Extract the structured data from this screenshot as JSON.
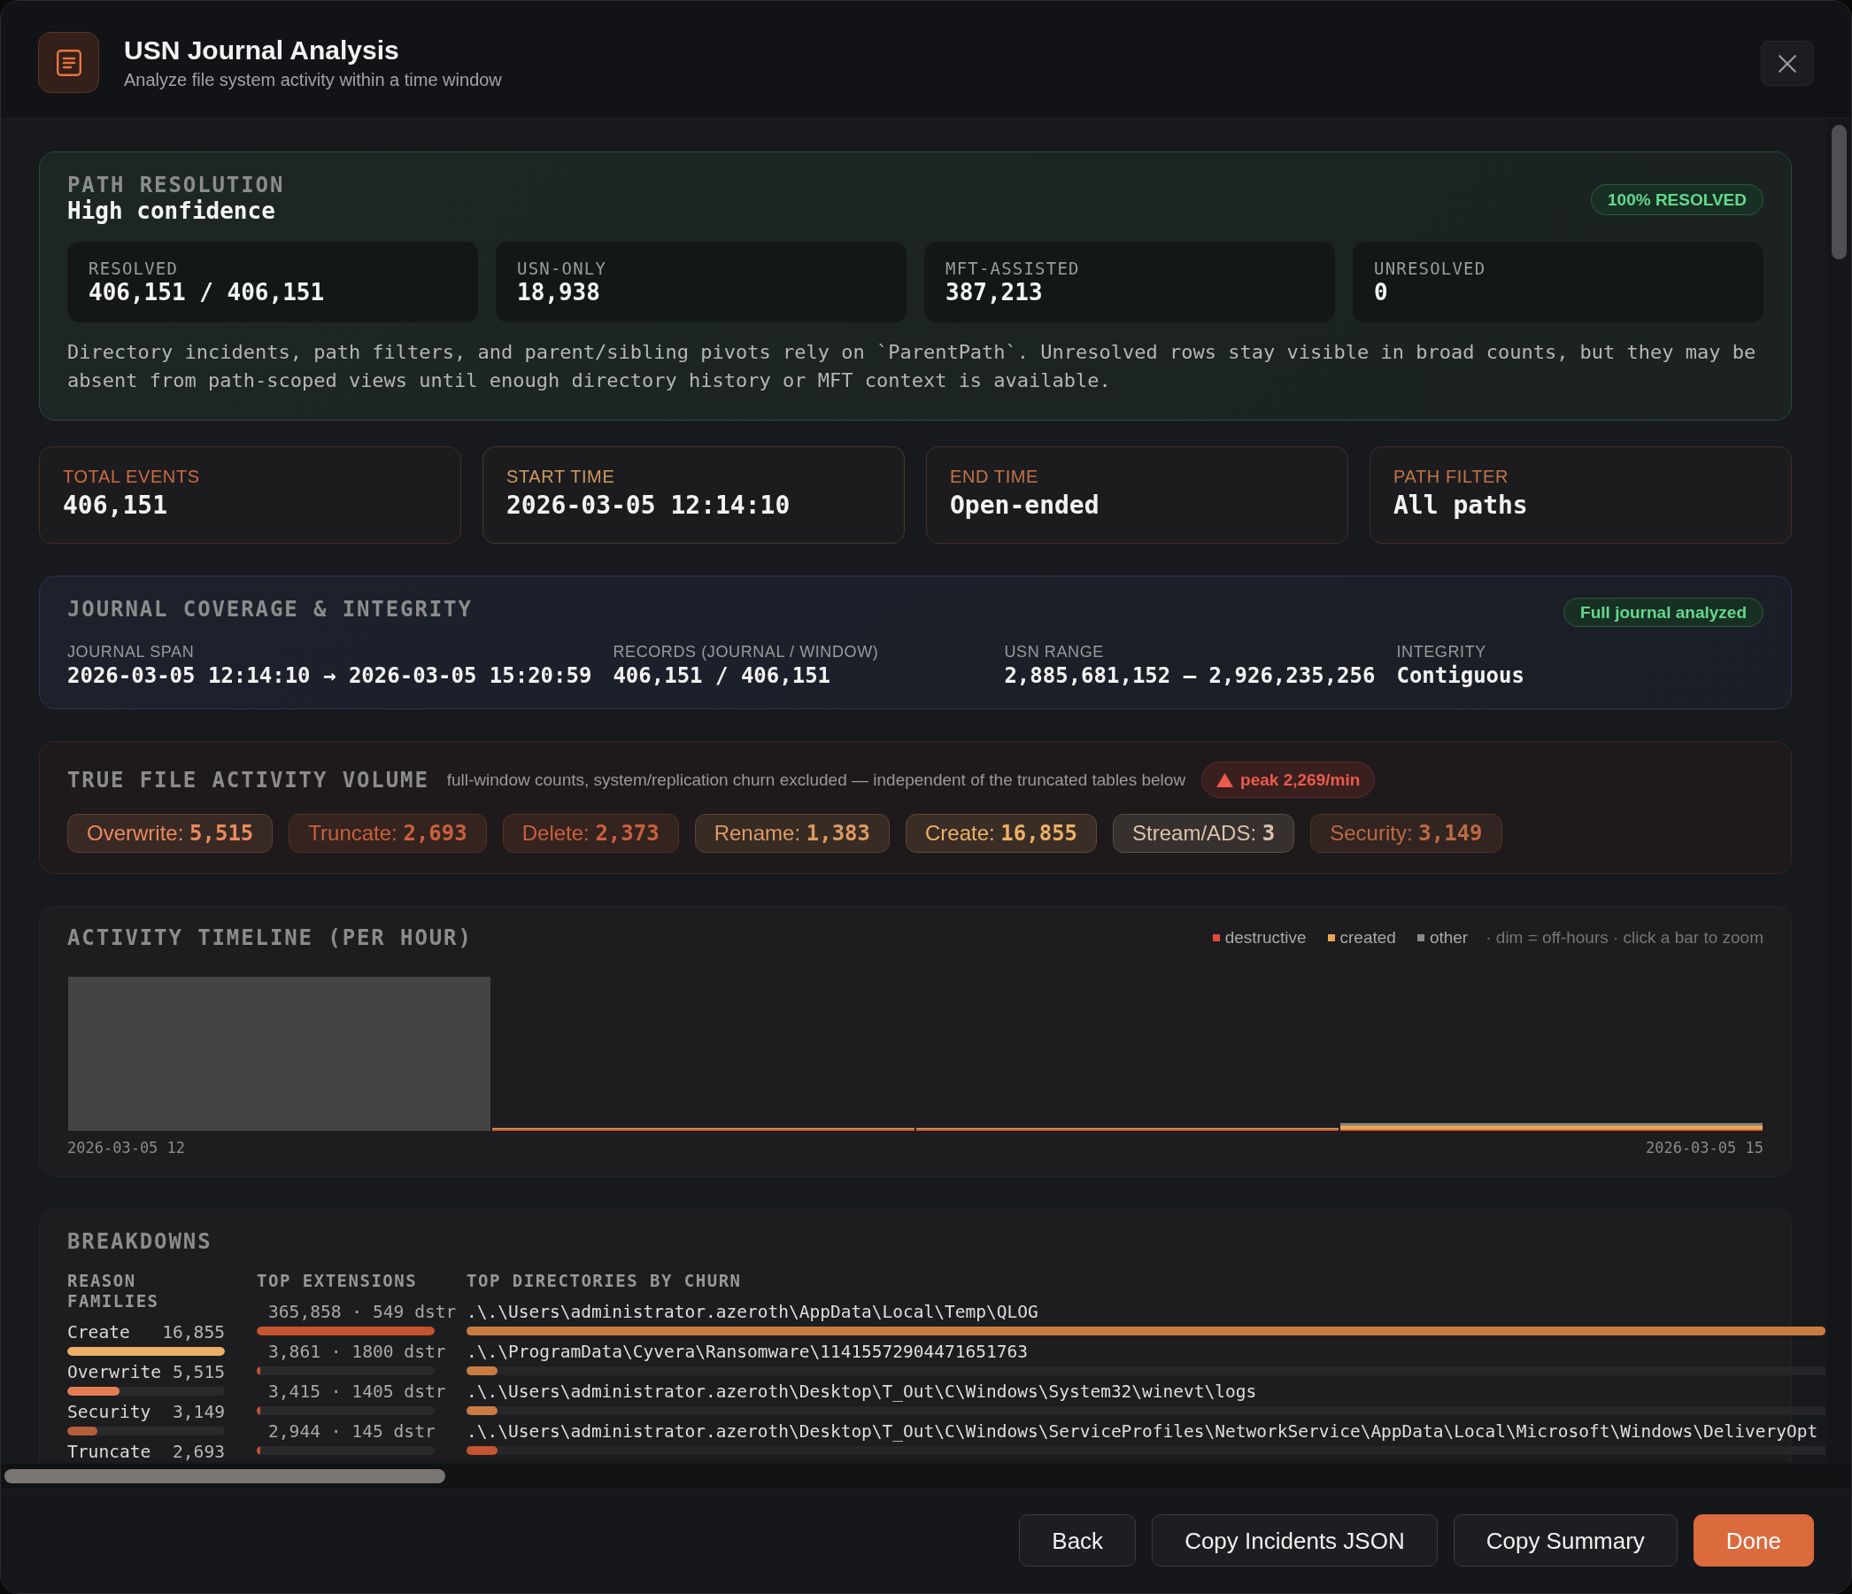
{
  "header": {
    "title": "USN Journal Analysis",
    "subtitle": "Analyze file system activity within a time window"
  },
  "path_resolution": {
    "heading": "PATH RESOLUTION",
    "confidence": "High confidence",
    "badge": "100% RESOLVED",
    "stats": [
      {
        "label": "RESOLVED",
        "value": "406,151 / 406,151"
      },
      {
        "label": "USN-ONLY",
        "value": "18,938"
      },
      {
        "label": "MFT-ASSISTED",
        "value": "387,213"
      },
      {
        "label": "UNRESOLVED",
        "value": "0"
      }
    ],
    "note": "Directory incidents, path filters, and parent/sibling pivots rely on `ParentPath`. Unresolved rows stay visible in broad counts, but they may be absent from path-scoped views until enough directory history or MFT context is available."
  },
  "summary_cards": [
    {
      "label": "TOTAL EVENTS",
      "value": "406,151",
      "color": "#cc6a40"
    },
    {
      "label": "START TIME",
      "value": "2026-03-05 12:14:10",
      "color": "#cf9a5e"
    },
    {
      "label": "END TIME",
      "value": "Open-ended",
      "color": "#c27446"
    },
    {
      "label": "PATH FILTER",
      "value": "All paths",
      "color": "#c27446"
    }
  ],
  "coverage": {
    "heading": "JOURNAL COVERAGE & INTEGRITY",
    "badge": "Full journal analyzed",
    "fields": [
      {
        "label": "JOURNAL SPAN",
        "value": "2026-03-05 12:14:10 → 2026-03-05 15:20:59"
      },
      {
        "label": "RECORDS (JOURNAL / WINDOW)",
        "value": "406,151 / 406,151"
      },
      {
        "label": "USN RANGE",
        "value": "2,885,681,152 – 2,926,235,256"
      },
      {
        "label": "INTEGRITY",
        "value": "Contiguous"
      }
    ]
  },
  "activity_volume": {
    "heading": "TRUE FILE ACTIVITY VOLUME",
    "note": "full-window counts, system/replication churn excluded — independent of the truncated tables below",
    "peak": "peak 2,269/min",
    "chips": [
      {
        "label": "Overwrite:",
        "value": "5,515",
        "color": "#ea8a5e"
      },
      {
        "label": "Truncate:",
        "value": "2,693",
        "color": "#c9603d"
      },
      {
        "label": "Delete:",
        "value": "2,373",
        "color": "#c9603d"
      },
      {
        "label": "Rename:",
        "value": "1,383",
        "color": "#dc9a62"
      },
      {
        "label": "Create:",
        "value": "16,855",
        "color": "#ebb066"
      },
      {
        "label": "Stream/ADS:",
        "value": "3",
        "color": "#d9c2aa"
      },
      {
        "label": "Security:",
        "value": "3,149",
        "color": "#bb6a44"
      }
    ]
  },
  "timeline": {
    "heading": "ACTIVITY TIMELINE (PER HOUR)",
    "legend": [
      {
        "label": "destructive",
        "color": "#e5483b"
      },
      {
        "label": "created",
        "color": "#e8a752"
      },
      {
        "label": "other",
        "color": "#8b8b8b"
      }
    ],
    "hint": "· dim = off-hours · click a bar to zoom",
    "axis_start": "2026-03-05 12",
    "axis_end": "2026-03-05 15"
  },
  "breakdowns": {
    "heading": "BREAKDOWNS",
    "reason_families": {
      "heading": "REASON FAMILIES",
      "rows": [
        {
          "name": "Create",
          "count": "16,855",
          "level": 1,
          "color": "#ebb066"
        },
        {
          "name": "Overwrite",
          "count": "5,515",
          "level": 0.33,
          "color": "#e47e52"
        },
        {
          "name": "Security",
          "count": "3,149",
          "level": 0.19,
          "color": "#b45e3c"
        },
        {
          "name": "Truncate",
          "count": "2,693"
        }
      ]
    },
    "top_extensions": {
      "heading": "TOP EXTENSIONS",
      "rows": [
        {
          "text": "365,858 · 549 dstr",
          "level": 1
        },
        {
          "text": "3,861 · 1800 dstr",
          "level": 0.02
        },
        {
          "text": "3,415 · 1405 dstr",
          "level": 0.02
        },
        {
          "text": "2,944 · 145 dstr",
          "level": 0.02
        }
      ]
    },
    "top_directories": {
      "heading": "TOP DIRECTORIES BY CHURN",
      "rows": [
        {
          "path": ".\\.\\Users\\administrator.azeroth\\AppData\\Local\\Temp\\QLOG",
          "level": 1,
          "color": "#c97c42"
        },
        {
          "path": ".\\.\\ProgramData\\Cyvera\\Ransomware\\11415572904471651763",
          "level": 0.023,
          "color": "#c97c42"
        },
        {
          "path": ".\\.\\Users\\administrator.azeroth\\Desktop\\T_Out\\C\\Windows\\System32\\winevt\\logs",
          "level": 0.023,
          "color": "#c97c42"
        },
        {
          "path": ".\\.\\Users\\administrator.azeroth\\Desktop\\T_Out\\C\\Windows\\ServiceProfiles\\NetworkService\\AppData\\Local\\Microsoft\\Windows\\DeliveryOpt",
          "level": 0.023,
          "color": "#c4532f"
        }
      ]
    }
  },
  "footer": {
    "buttons": [
      {
        "label": "Back",
        "kind": "secondary"
      },
      {
        "label": "Copy Incidents JSON",
        "kind": "secondary"
      },
      {
        "label": "Copy Summary",
        "kind": "secondary"
      },
      {
        "label": "Done",
        "kind": "primary"
      }
    ]
  }
}
